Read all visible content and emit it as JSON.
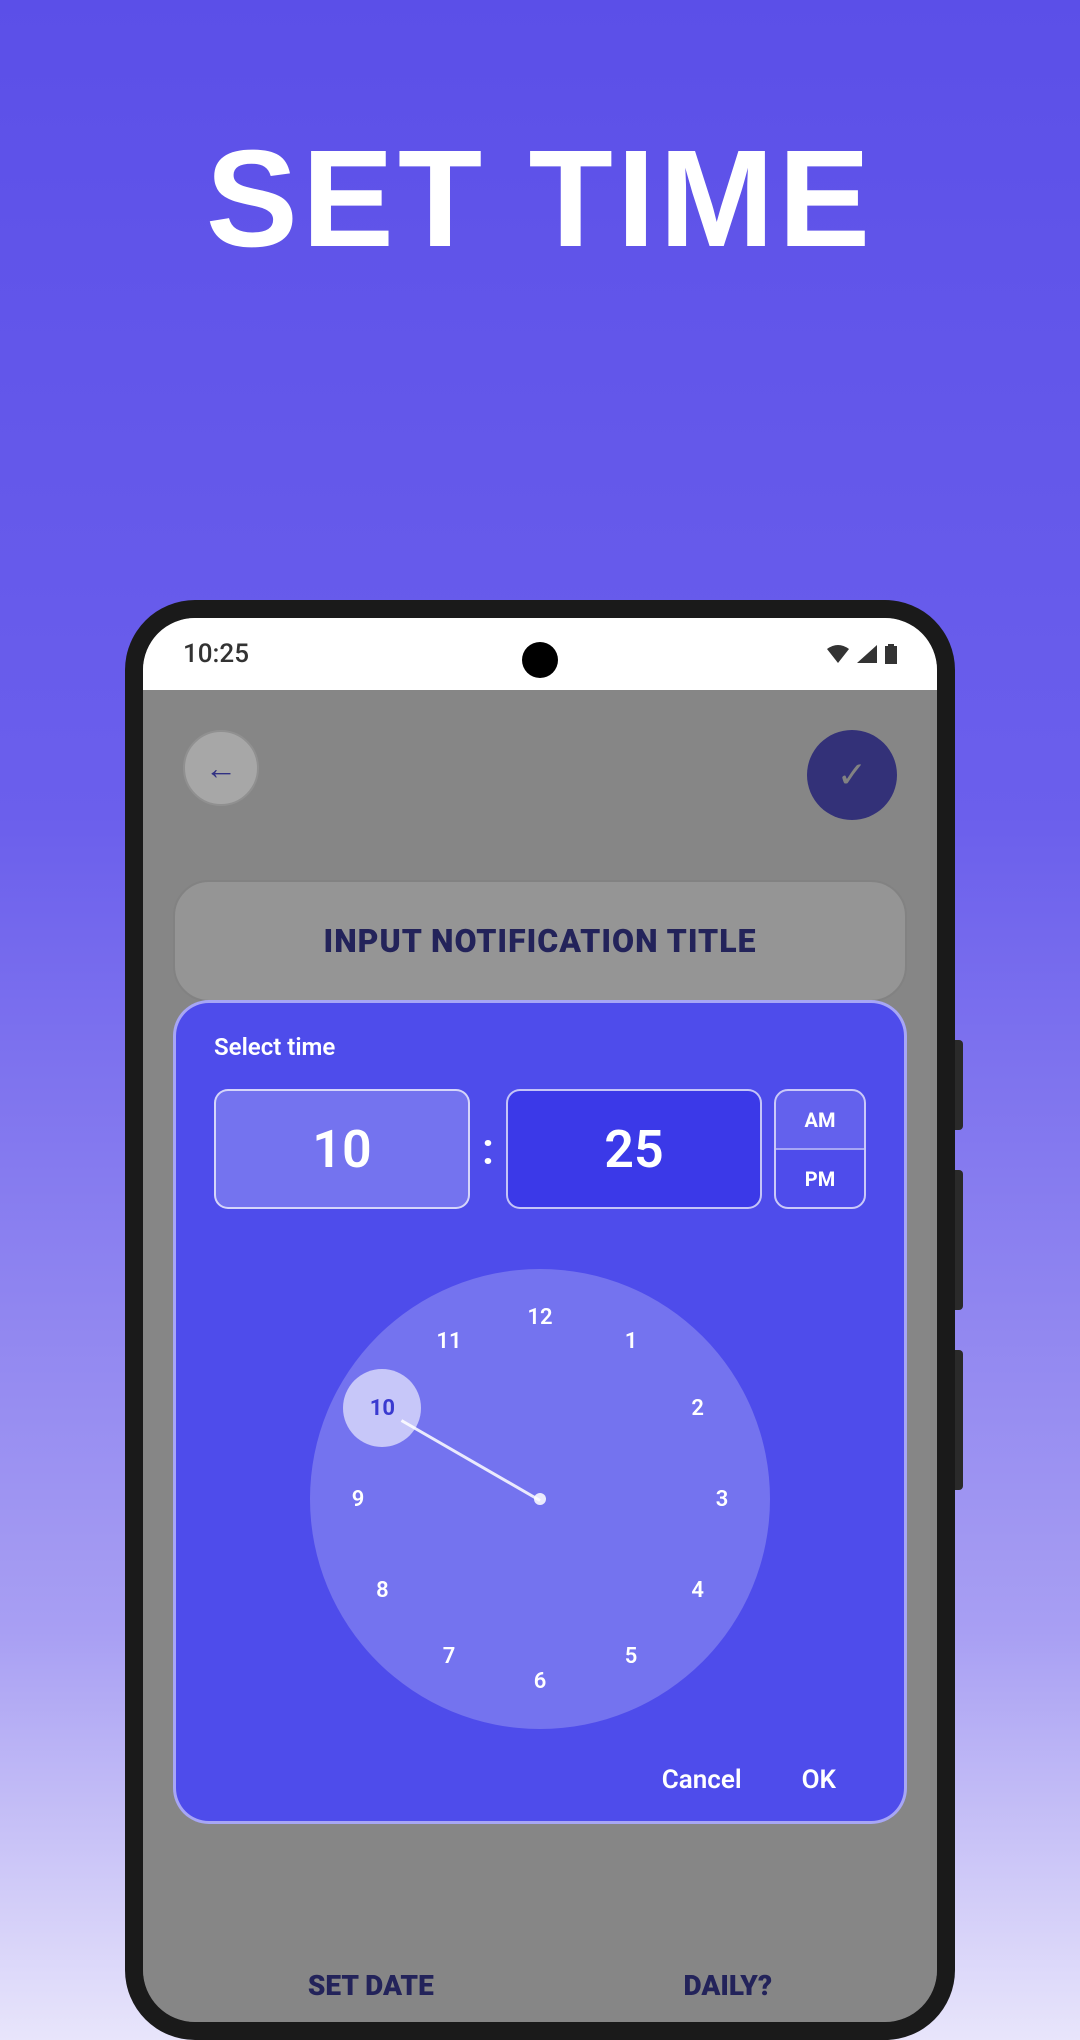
{
  "headline": "SET TIME",
  "statusBar": {
    "time": "10:25"
  },
  "appHeader": {
    "backIcon": "←",
    "confirmIcon": "✓"
  },
  "card": {
    "title": "INPUT NOTIFICATION TITLE"
  },
  "bottom": {
    "setDate": "SET DATE",
    "daily": "DAILY?"
  },
  "picker": {
    "title": "Select time",
    "hour": "10",
    "minute": "25",
    "colon": ":",
    "am": "AM",
    "pm": "PM",
    "selectedPeriod": "AM",
    "clockNumbers": [
      "12",
      "1",
      "2",
      "3",
      "4",
      "5",
      "6",
      "7",
      "8",
      "9",
      "10",
      "11"
    ],
    "selectedHour": "10",
    "cancel": "Cancel",
    "ok": "OK"
  }
}
